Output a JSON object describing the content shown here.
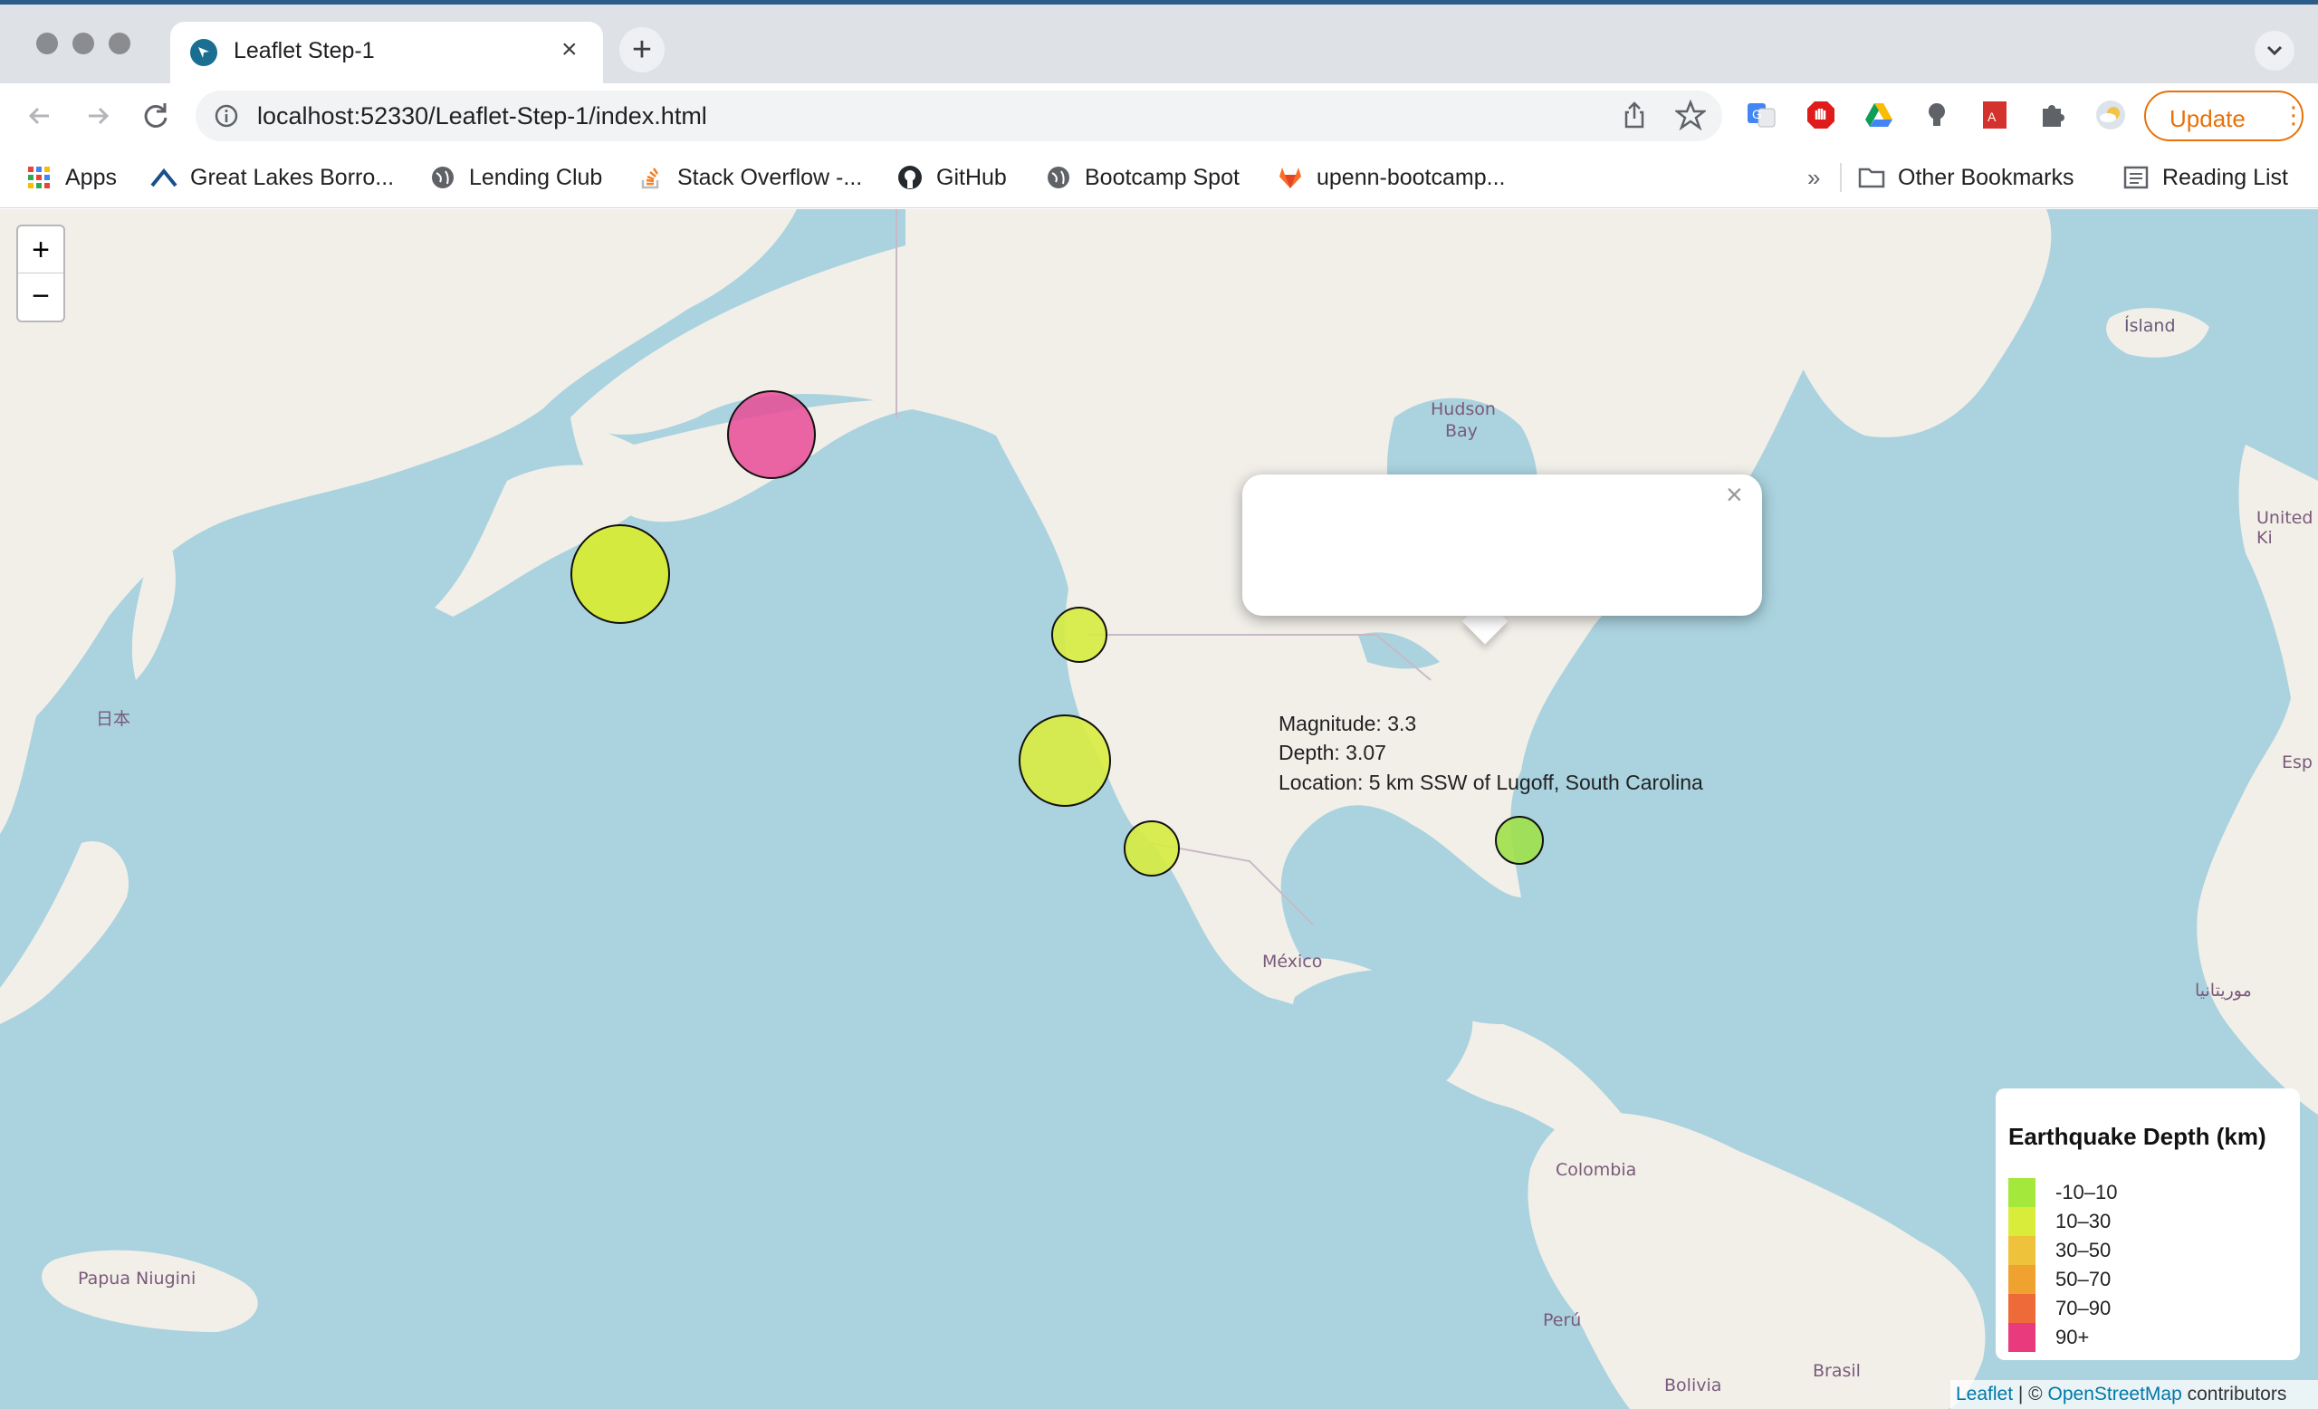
{
  "browser": {
    "tab_title": "Leaflet Step-1",
    "tab_close": "×",
    "new_tab": "+",
    "url": "localhost:52330/Leaflet-Step-1/index.html",
    "update_label": "Update",
    "update_menu": "⋮"
  },
  "bookmarks": {
    "items": [
      {
        "label": "Apps",
        "icon": "apps-grid-icon"
      },
      {
        "label": "Great Lakes Borro...",
        "icon": "great-lakes-icon"
      },
      {
        "label": "Lending Club",
        "icon": "globe-icon"
      },
      {
        "label": "Stack Overflow -...",
        "icon": "stack-overflow-icon"
      },
      {
        "label": "GitHub",
        "icon": "github-icon"
      },
      {
        "label": "Bootcamp Spot",
        "icon": "globe-icon"
      },
      {
        "label": "upenn-bootcamp...",
        "icon": "gitlab-icon"
      }
    ],
    "overflow": "»",
    "other_bookmarks": "Other Bookmarks",
    "reading_list": "Reading List"
  },
  "map": {
    "zoom_in": "+",
    "zoom_out": "−",
    "labels": {
      "hudson_bay_1": "Hudson",
      "hudson_bay_2": "Bay",
      "island": "Ísland",
      "united_kingdom": "United Ki",
      "espana": "Esp",
      "japan": "日本",
      "mexico": "México",
      "colombia": "Colombia",
      "peru": "Perú",
      "brasil": "Brasil",
      "bolivia": "Bolivia",
      "papua": "Papua Niugini",
      "mauritania": "موريتانيا"
    },
    "earthquakes": [
      {
        "name": "alaska-quake",
        "magnitude_class": "large",
        "color": "#e94b96",
        "depth_band": "90+"
      },
      {
        "name": "aleutian-quake",
        "magnitude_class": "large",
        "color": "#d8ec2c",
        "depth_band": "10–30"
      },
      {
        "name": "washington-quake",
        "magnitude_class": "small",
        "color": "#d6ec40",
        "depth_band": "10–30"
      },
      {
        "name": "california-north-quake",
        "magnitude_class": "large",
        "color": "#d8ec40",
        "depth_band": "10–30"
      },
      {
        "name": "california-south-quake",
        "magnitude_class": "small",
        "color": "#d6ec40",
        "depth_band": "10–30"
      },
      {
        "name": "south-carolina-quake",
        "magnitude_class": "small",
        "color": "#9ee04a",
        "depth_band": "-10–10"
      }
    ],
    "popup": {
      "magnitude": "Magnitude: 3.3",
      "depth": "Depth: 3.07",
      "location": "Location: 5 km SSW of Lugoff, South Carolina",
      "close": "×"
    },
    "legend": {
      "title": "Earthquake Depth (km)",
      "items": [
        {
          "label": "-10–10",
          "color": "#a3e83a"
        },
        {
          "label": "10–30",
          "color": "#d9ec3a"
        },
        {
          "label": "30–50",
          "color": "#eec23a"
        },
        {
          "label": "50–70",
          "color": "#f0a230"
        },
        {
          "label": "70–90",
          "color": "#ee6a38"
        },
        {
          "label": "90+",
          "color": "#e83a7c"
        }
      ]
    },
    "attribution": {
      "leaflet": "Leaflet",
      "separator": " | © ",
      "osm": "OpenStreetMap",
      "contributors": " contributors"
    }
  }
}
